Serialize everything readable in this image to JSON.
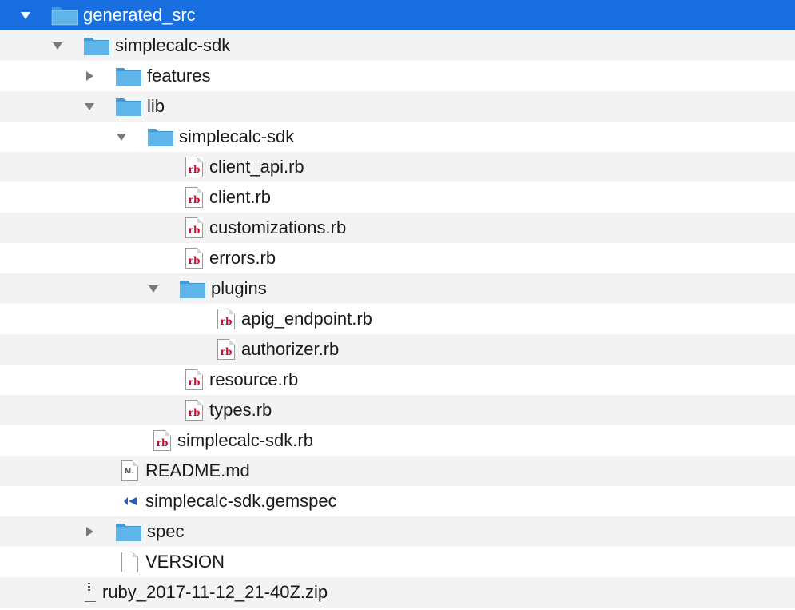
{
  "colors": {
    "selection": "#1a6fe0",
    "folder": "#5fb4ea",
    "folder_tab": "#3e9ad8",
    "ruby_text": "#c8102e",
    "disclosure": "#7a7a7a"
  },
  "icons": {
    "folder": "folder-icon",
    "ruby_file": "ruby-file-icon",
    "markdown_file": "markdown-file-icon",
    "gemspec_file": "gemspec-file-icon",
    "plain_file": "plain-file-icon",
    "zip_file": "zip-file-icon",
    "expanded": "disclosure-triangle-down-icon",
    "collapsed": "disclosure-triangle-right-icon"
  },
  "ruby_badge": "rb",
  "markdown_badge": "M↓",
  "rows": [
    {
      "name": "generated_src",
      "type": "folder",
      "disclosure": "expanded",
      "depth": 0,
      "selected": true
    },
    {
      "name": "simplecalc-sdk",
      "type": "folder",
      "disclosure": "expanded",
      "depth": 1
    },
    {
      "name": "features",
      "type": "folder",
      "disclosure": "collapsed",
      "depth": 2
    },
    {
      "name": "lib",
      "type": "folder",
      "disclosure": "expanded",
      "depth": 2
    },
    {
      "name": "simplecalc-sdk",
      "type": "folder",
      "disclosure": "expanded",
      "depth": 3
    },
    {
      "name": "client_api.rb",
      "type": "ruby",
      "depth": 4
    },
    {
      "name": "client.rb",
      "type": "ruby",
      "depth": 4
    },
    {
      "name": "customizations.rb",
      "type": "ruby",
      "depth": 4
    },
    {
      "name": "errors.rb",
      "type": "ruby",
      "depth": 4
    },
    {
      "name": "plugins",
      "type": "folder",
      "disclosure": "expanded",
      "depth": 4
    },
    {
      "name": "apig_endpoint.rb",
      "type": "ruby",
      "depth": 5
    },
    {
      "name": "authorizer.rb",
      "type": "ruby",
      "depth": 5
    },
    {
      "name": "resource.rb",
      "type": "ruby",
      "depth": 4
    },
    {
      "name": "types.rb",
      "type": "ruby",
      "depth": 4
    },
    {
      "name": "simplecalc-sdk.rb",
      "type": "ruby",
      "depth": 3
    },
    {
      "name": "README.md",
      "type": "markdown",
      "depth": 2
    },
    {
      "name": "simplecalc-sdk.gemspec",
      "type": "gemspec",
      "depth": 2
    },
    {
      "name": "spec",
      "type": "folder",
      "disclosure": "collapsed",
      "depth": 2
    },
    {
      "name": "VERSION",
      "type": "plain",
      "depth": 2
    },
    {
      "name": "ruby_2017-11-12_21-40Z.zip",
      "type": "zip",
      "depth": 1
    }
  ]
}
